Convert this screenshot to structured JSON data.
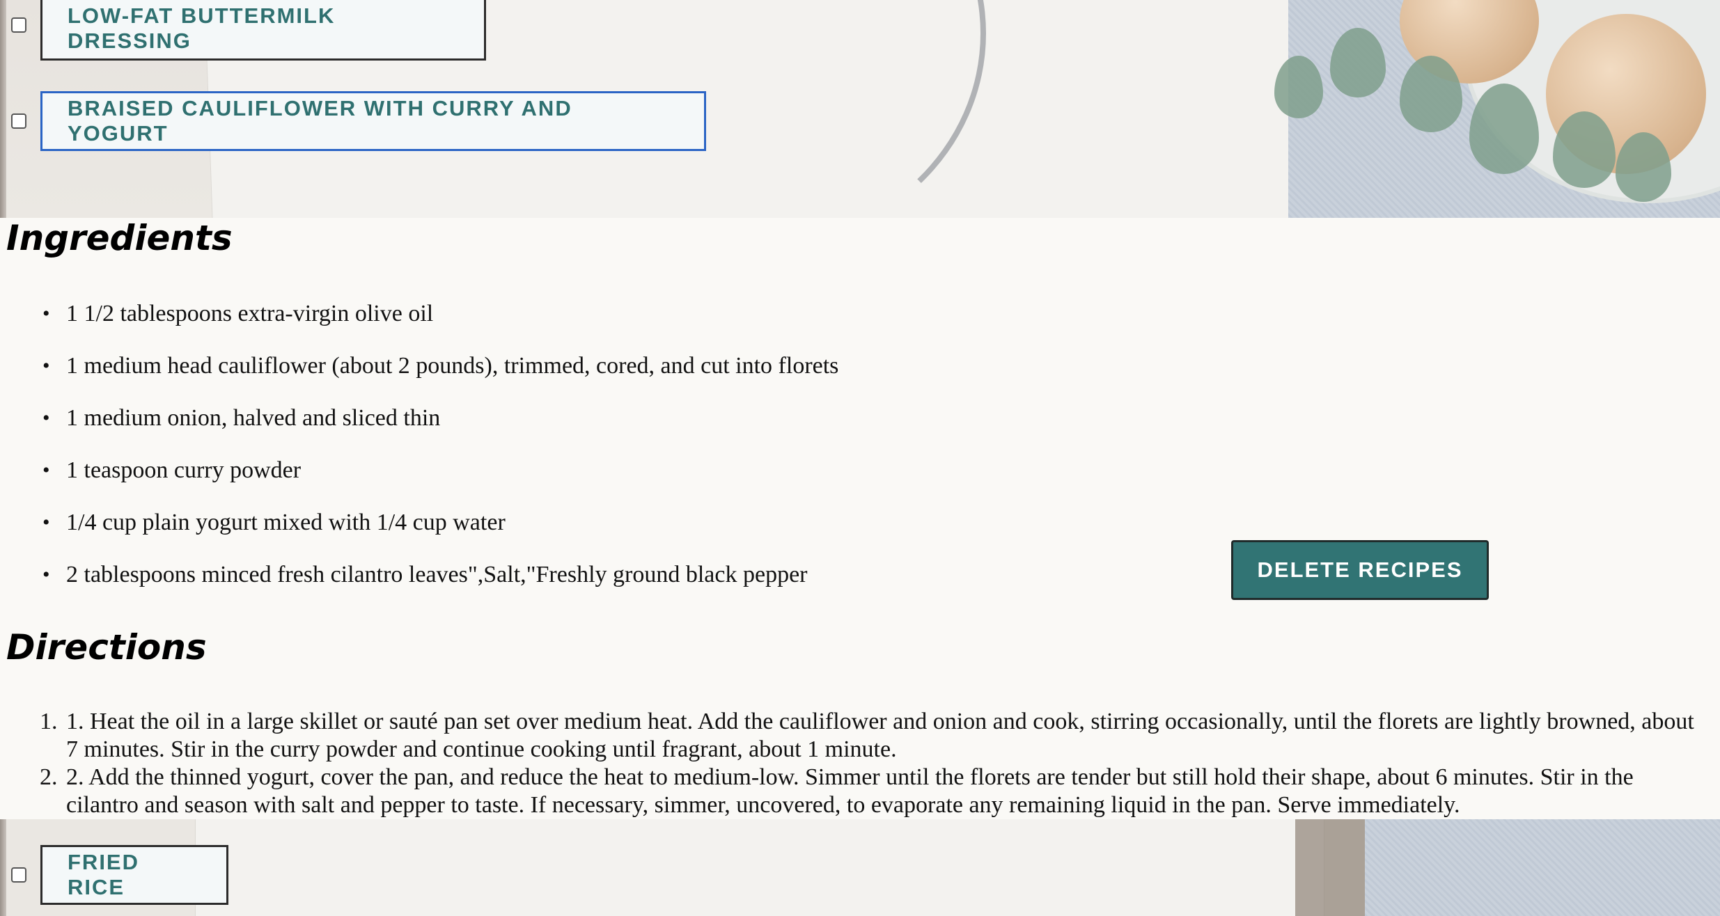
{
  "recipes": [
    {
      "label": "LOW-FAT BUTTERMILK DRESSING",
      "checked": false,
      "selected": false
    },
    {
      "label": "BRAISED CAULIFLOWER WITH CURRY AND YOGURT",
      "checked": false,
      "selected": true
    },
    {
      "label": "FRIED RICE",
      "checked": false,
      "selected": false
    }
  ],
  "detail": {
    "ingredients_title": "Ingredients",
    "ingredients": [
      "1 1/2 tablespoons extra-virgin olive oil",
      "1 medium head cauliflower (about 2 pounds), trimmed, cored, and cut into florets",
      "1 medium onion, halved and sliced thin",
      "1 teaspoon curry powder",
      "1/4 cup plain yogurt mixed with 1/4 cup water",
      "2 tablespoons minced fresh cilantro leaves\",Salt,\"Freshly ground black pepper"
    ],
    "directions_title": "Directions",
    "directions": [
      "1. Heat the oil in a large skillet or sauté pan set over medium heat. Add the cauliflower and onion and cook, stirring occasionally, until the florets are lightly browned, about 7 minutes. Stir in the curry powder and continue cooking until fragrant, about 1 minute.",
      "2. Add the thinned yogurt, cover the pan, and reduce the heat to medium-low. Simmer until the florets are tender but still hold their shape, about 6 minutes. Stir in the cilantro and season with salt and pepper to taste. If necessary, simmer, uncovered, to evaporate any remaining liquid in the pan. Serve immediately."
    ],
    "delete_label": "DELETE RECIPES"
  },
  "colors": {
    "accent": "#317474",
    "button_text": "#2f7070",
    "selected_border": "#2a64c5",
    "panel_bg": "#faf9f6"
  },
  "list_markers": {
    "bullet": "•",
    "numbers": [
      "1.",
      "2."
    ]
  }
}
